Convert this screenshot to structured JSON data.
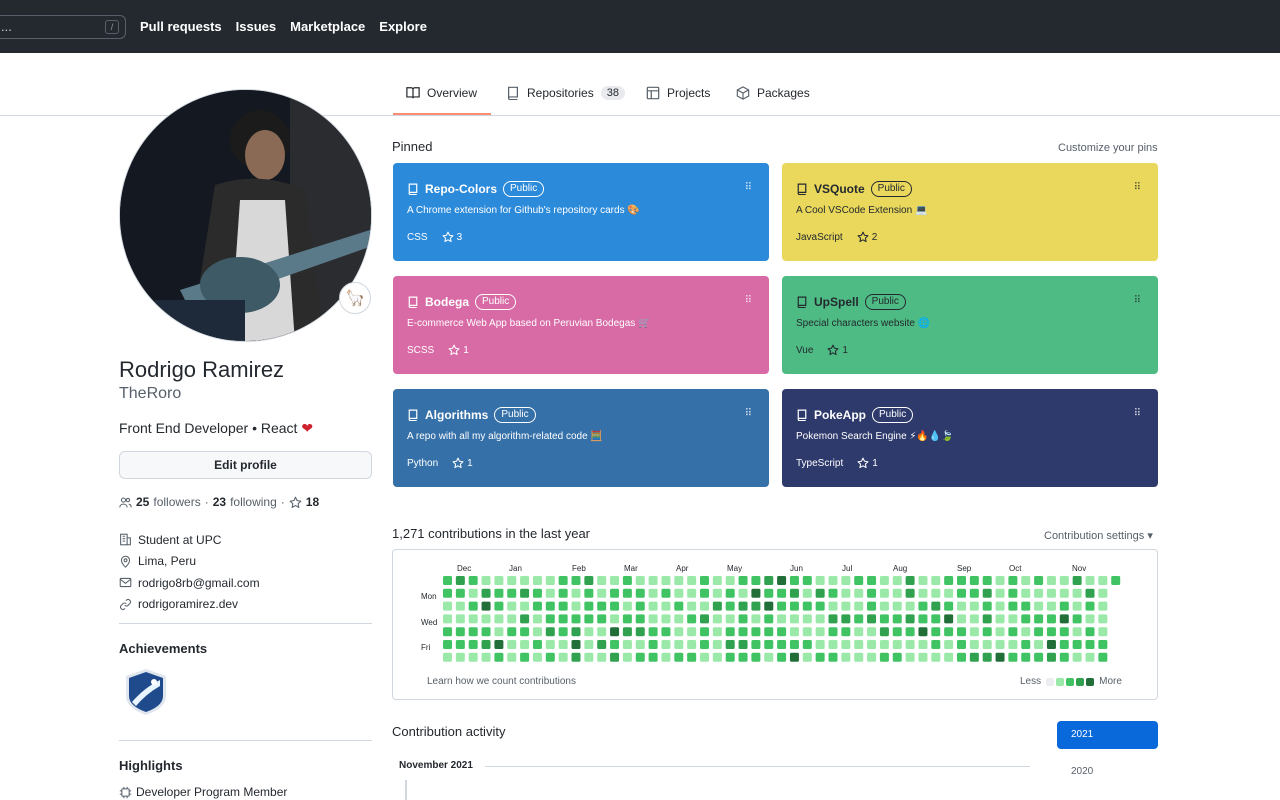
{
  "topbar": {
    "search_text": "...",
    "search_shortcut": "/",
    "nav": [
      "Pull requests",
      "Issues",
      "Marketplace",
      "Explore"
    ]
  },
  "tabs": [
    {
      "label": "Overview",
      "icon": "book-icon",
      "active": true
    },
    {
      "label": "Repositories",
      "icon": "repo-icon",
      "count": "38"
    },
    {
      "label": "Projects",
      "icon": "table-icon"
    },
    {
      "label": "Packages",
      "icon": "package-icon"
    }
  ],
  "profile": {
    "name": "Rodrigo Ramirez",
    "login": "TheRoro",
    "bio": "Front End Developer • React",
    "bio_emoji": "❤",
    "status_emoji": "🦙",
    "edit_label": "Edit profile",
    "followers": "25",
    "followers_label": "followers",
    "following": "23",
    "following_label": "following",
    "stars": "18",
    "details": [
      {
        "icon": "organization-icon",
        "text": "Student at UPC"
      },
      {
        "icon": "location-icon",
        "text": "Lima, Peru"
      },
      {
        "icon": "mail-icon",
        "text": "rodrigo8rb@gmail.com"
      },
      {
        "icon": "link-icon",
        "text": "rodrigoramirez.dev"
      }
    ],
    "achievements_title": "Achievements",
    "highlights_title": "Highlights",
    "highlight_item": "Developer Program Member"
  },
  "pinned": {
    "title": "Pinned",
    "customize": "Customize your pins",
    "cards": [
      {
        "name": "Repo-Colors",
        "badge": "Public",
        "desc": "A Chrome extension for Github's repository cards 🎨",
        "lang": "CSS",
        "stars": "3",
        "bg": "#2b8ad9",
        "fg": "#ffffff"
      },
      {
        "name": "VSQuote",
        "badge": "Public",
        "desc": "A Cool VSCode Extension 💻",
        "lang": "JavaScript",
        "stars": "2",
        "bg": "#e9d85b",
        "fg": "#24292f"
      },
      {
        "name": "Bodega",
        "badge": "Public",
        "desc": "E-commerce Web App based on Peruvian Bodegas 🛒",
        "lang": "SCSS",
        "stars": "1",
        "bg": "#d86aa5",
        "fg": "#ffffff"
      },
      {
        "name": "UpSpell",
        "badge": "Public",
        "desc": "Special characters website 🌐",
        "lang": "Vue",
        "stars": "1",
        "bg": "#4dbb83",
        "fg": "#24292f"
      },
      {
        "name": "Algorithms",
        "badge": "Public",
        "desc": "A repo with all my algorithm-related code 🧮",
        "lang": "Python",
        "stars": "1",
        "bg": "#3570a8",
        "fg": "#ffffff"
      },
      {
        "name": "PokeApp",
        "badge": "Public",
        "desc": "Pokemon Search Engine ⚡🔥💧🍃",
        "lang": "TypeScript",
        "stars": "1",
        "bg": "#2e3a6b",
        "fg": "#ffffff"
      }
    ]
  },
  "contributions": {
    "title": "1,271 contributions in the last year",
    "settings": "Contribution settings ▾",
    "months": [
      "Dec",
      "Jan",
      "Feb",
      "Mar",
      "Apr",
      "May",
      "Jun",
      "Jul",
      "Aug",
      "Sep",
      "Oct",
      "Nov"
    ],
    "days": [
      "Mon",
      "Wed",
      "Fri"
    ],
    "learn": "Learn how we count contributions",
    "less": "Less",
    "more": "More",
    "colors": [
      "#ebedf0",
      "#9be9a8",
      "#40c463",
      "#30a14e",
      "#216e39"
    ]
  },
  "activity": {
    "title": "Contribution activity",
    "month": "November 2021",
    "years": [
      "2021",
      "2020"
    ]
  }
}
